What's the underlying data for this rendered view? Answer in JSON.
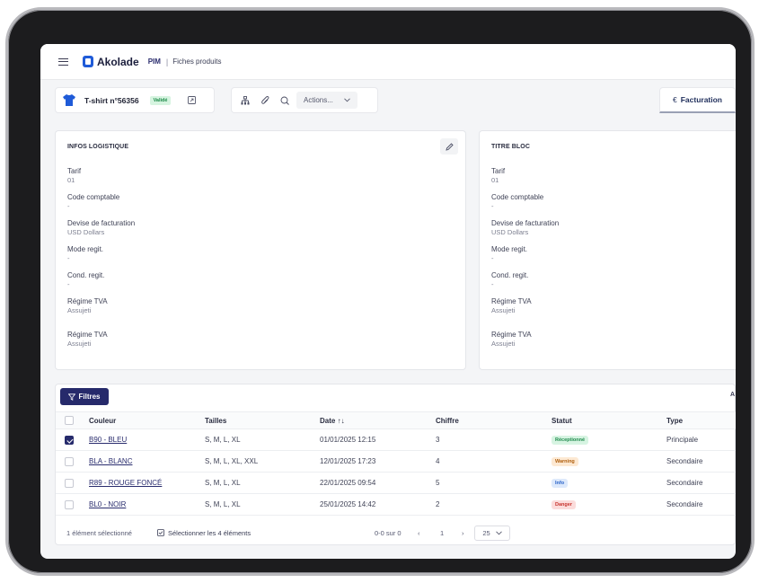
{
  "header": {
    "brand": "Akolade",
    "module": "PIM",
    "separator": "|",
    "breadcrumb": "Fiches produits"
  },
  "product": {
    "title": "T-shirt n°56356",
    "status_badge": "Validé",
    "actions_label": "Actions..."
  },
  "tabs": {
    "billing": "Facturation"
  },
  "logistics_card": {
    "title": "INFOS LOGISTIQUE",
    "fields": [
      {
        "label": "Tarif",
        "value": "01"
      },
      {
        "label": "Code comptable",
        "value": "-"
      },
      {
        "label": "Devise de facturation",
        "value": "USD Dollars"
      },
      {
        "label": "Mode regit.",
        "value": "-"
      },
      {
        "label": "Cond. regit.",
        "value": "-"
      },
      {
        "label": "Régime TVA",
        "value": "Assujeti"
      },
      {
        "label": "Régime TVA",
        "value": "Assujeti"
      }
    ]
  },
  "second_card": {
    "title": "TITRE BLOC",
    "fields": [
      {
        "label": "Tarif",
        "value": "01"
      },
      {
        "label": "Code comptable",
        "value": "-"
      },
      {
        "label": "Devise de facturation",
        "value": "USD Dollars"
      },
      {
        "label": "Mode regit.",
        "value": "-"
      },
      {
        "label": "Cond. regit.",
        "value": "-"
      },
      {
        "label": "Régime TVA",
        "value": "Assujeti"
      },
      {
        "label": "Régime TVA",
        "value": "Assujeti"
      }
    ]
  },
  "table": {
    "filters_label": "Filtres",
    "toolbar_right": "A",
    "columns": {
      "couleur": "Couleur",
      "tailles": "Tailles",
      "date": "Date ↑↓",
      "chiffre": "Chiffre",
      "statut": "Statut",
      "type": "Type"
    },
    "rows": [
      {
        "checked": true,
        "couleur": "B90 - BLEU",
        "tailles": "S, M, L, XL",
        "date": "01/01/2025 12:15",
        "chiffre": "3",
        "statut": "Réceptionné",
        "statut_color": "#1f8a4c",
        "statut_bg": "#d7f4e2",
        "type": "Principale"
      },
      {
        "checked": false,
        "couleur": "BLA - BLANC",
        "tailles": "S, M, L, XL, XXL",
        "date": "12/01/2025 17:23",
        "chiffre": "4",
        "statut": "Warning",
        "statut_color": "#b0600f",
        "statut_bg": "#fde9d3",
        "type": "Secondaire"
      },
      {
        "checked": false,
        "couleur": "R89 - ROUGE FONCÉ",
        "tailles": "S, M, L, XL",
        "date": "22/01/2025 09:54",
        "chiffre": "5",
        "statut": "Info",
        "statut_color": "#2a63c8",
        "statut_bg": "#dde9fb",
        "type": "Secondaire"
      },
      {
        "checked": false,
        "couleur": "BL0 - NOIR",
        "tailles": "S, M, L, XL",
        "date": "25/01/2025 14:42",
        "chiffre": "2",
        "statut": "Danger",
        "statut_color": "#c8352f",
        "statut_bg": "#fbdcdb",
        "type": "Secondaire"
      }
    ],
    "footer": {
      "selected": "1 élément sélectionné",
      "select_all": "Sélectionner les 4 éléments",
      "range": "0-0 sur 0",
      "page": "1",
      "page_size": "25"
    }
  },
  "colors": {
    "accent": "#262a6b",
    "brand": "#1f5bd8"
  }
}
